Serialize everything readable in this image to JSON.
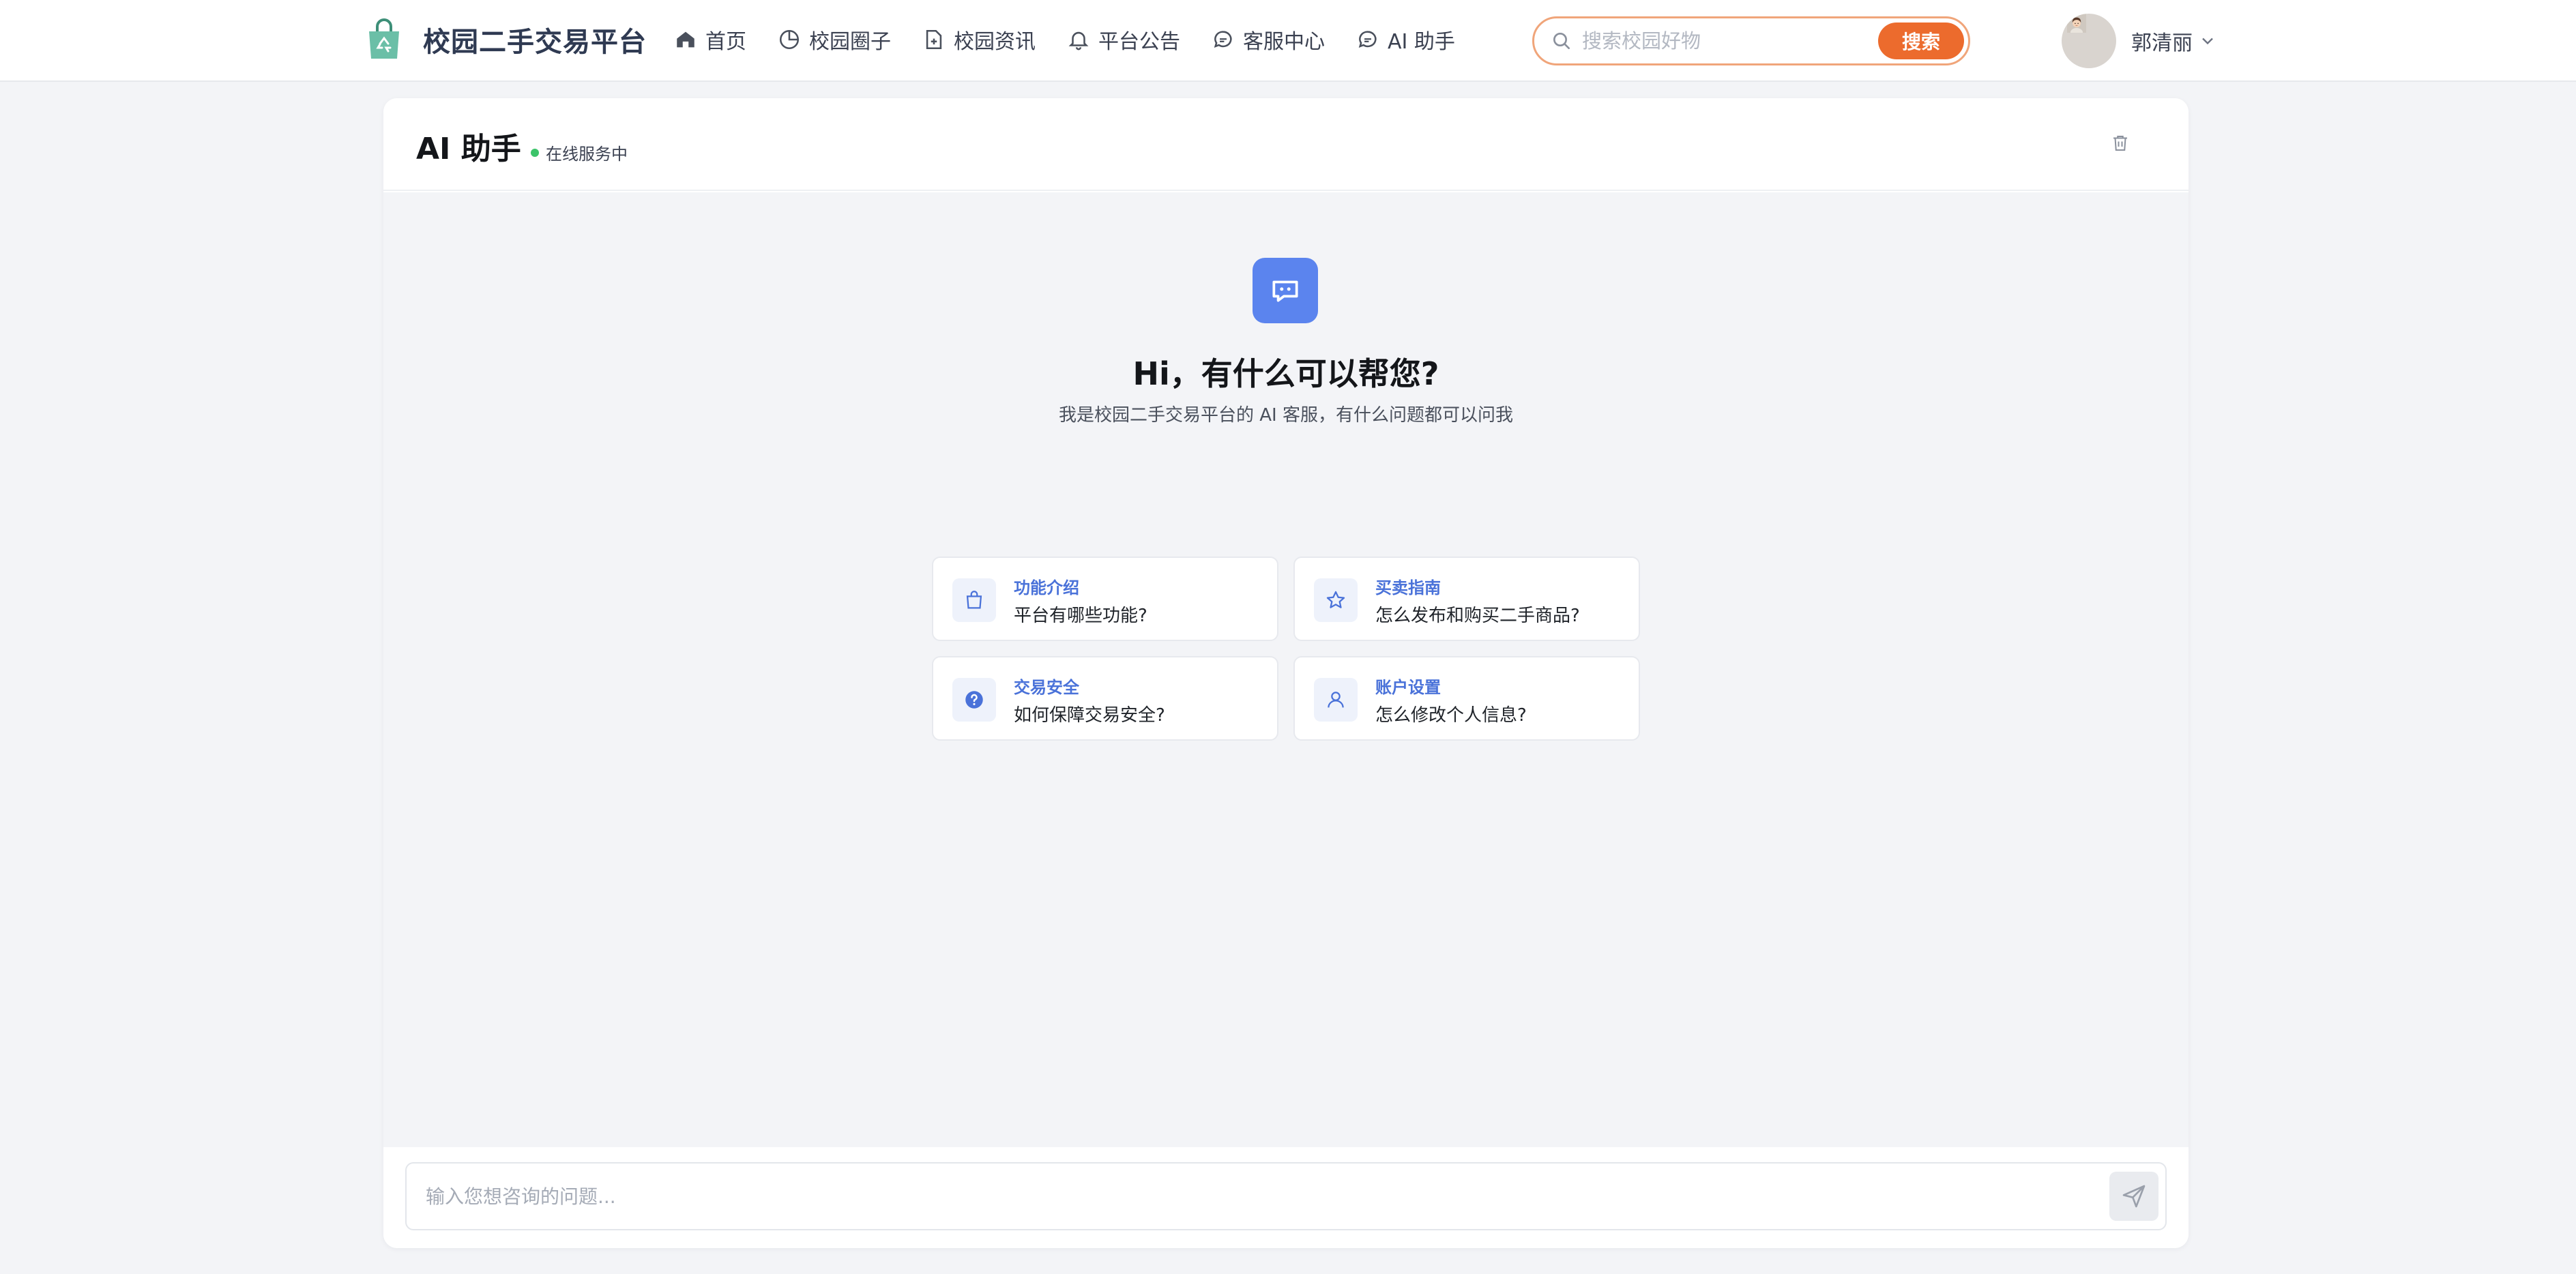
{
  "app": {
    "brand": "校园二手交易平台"
  },
  "nav": {
    "items": [
      {
        "label": "首页",
        "icon": "home-icon"
      },
      {
        "label": "校园圈子",
        "icon": "pie-chart-icon"
      },
      {
        "label": "校园资讯",
        "icon": "document-plus-icon"
      },
      {
        "label": "平台公告",
        "icon": "bell-icon"
      },
      {
        "label": "客服中心",
        "icon": "chat-bubble-icon"
      },
      {
        "label": "AI 助手",
        "icon": "chat-bubble-icon"
      }
    ]
  },
  "search": {
    "placeholder": "搜索校园好物",
    "button_label": "搜索"
  },
  "user": {
    "name": "郭清丽"
  },
  "chat": {
    "title": "AI 助手",
    "status": "在线服务中",
    "greeting": "Hi，有什么可以帮您?",
    "subtitle": "我是校园二手交易平台的 AI 客服，有什么问题都可以问我",
    "suggestions": [
      {
        "category": "功能介绍",
        "question": "平台有哪些功能?",
        "icon": "shopping-bag-icon"
      },
      {
        "category": "买卖指南",
        "question": "怎么发布和购买二手商品?",
        "icon": "star-icon"
      },
      {
        "category": "交易安全",
        "question": "如何保障交易安全?",
        "icon": "question-circle-icon"
      },
      {
        "category": "账户设置",
        "question": "怎么修改个人信息?",
        "icon": "user-icon"
      }
    ],
    "input_placeholder": "输入您想咨询的问题..."
  },
  "colors": {
    "accent_orange": "#ec6b2d",
    "accent_blue": "#5b84ee",
    "status_green": "#3cc46a",
    "logo_green": "#6bbfa7"
  }
}
